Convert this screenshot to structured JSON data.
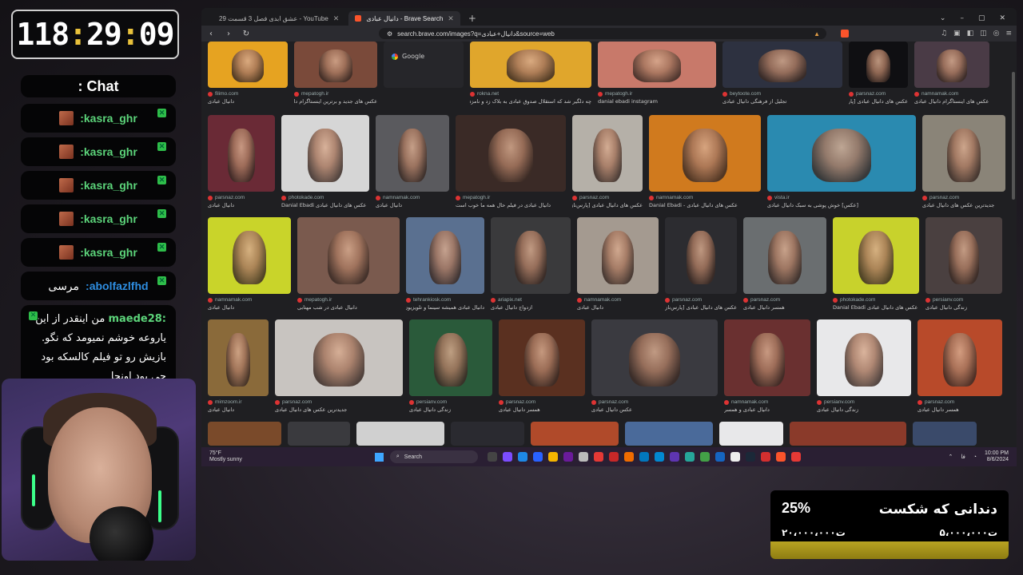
{
  "timer": {
    "hours": "118",
    "minutes": "29",
    "seconds": "09"
  },
  "chat": {
    "title": ": Chat",
    "messages": [
      {
        "user": ":kasra_ghr",
        "text": ""
      },
      {
        "user": ":kasra_ghr",
        "text": ""
      },
      {
        "user": ":kasra_ghr",
        "text": ""
      },
      {
        "user": ":kasra_ghr",
        "text": ""
      },
      {
        "user": ":kasra_ghr",
        "text": ""
      },
      {
        "user": ":abolfazlfhd",
        "text": "مرسی"
      }
    ],
    "long_message": {
      "user": ":maede28",
      "text": "من اینقدر از این یاروعه خوشم نمیومد که نگو. بازیش رو تو فیلم کالسکه بود چی بود اونجا"
    }
  },
  "browser": {
    "tabs": [
      {
        "label": "عشق ابدی فصل 3 قسمت 29 - YouTube",
        "active": false
      },
      {
        "label": "دانیال عبادی - Brave Search",
        "active": true
      }
    ],
    "url": "search.brave.com/images?q=دانیال+عبادی&source=web",
    "partial_card_label": "Google"
  },
  "rows": [
    {
      "cards": [
        {
          "src": "filimo.com",
          "cap": "دانیال عبادی",
          "color": "#e6a321"
        },
        {
          "src": "mepatogh.ir",
          "cap": "عکس های جدید و برترین اینستاگرام دانیال عبادی",
          "color": "#7a4a3a"
        },
        {
          "src": "",
          "cap": "",
          "color": "#26262a"
        },
        {
          "src": "rokna.net",
          "cap": "چه دلگیر شد که استقلال صدوق عبادی به بلاک زد و نامزدی حاضر شد",
          "color": "#e0a62c"
        },
        {
          "src": "mepatogh.ir",
          "cap": "danial ebadi instagram",
          "color": "#c8796a"
        },
        {
          "src": "beytoote.com",
          "cap": "تجلیل از فرهنگی دانیال عبادی",
          "color": "#2d3140"
        },
        {
          "src": "parsnaz.com",
          "cap": "عکس های دانیال عبادی [پارس‌ناز]",
          "color": "#0f0f12"
        },
        {
          "src": "namnamak.com",
          "cap": "عکس های اینستاگرام دانیال عبادی",
          "color": "#4a3b46"
        }
      ]
    },
    {
      "cards": [
        {
          "src": "parsnaz.com",
          "cap": "دانیال عبادی",
          "color": "#6a2a36"
        },
        {
          "src": "photokade.com",
          "cap": "عکس های دانیال عبادی Danial Ebadi",
          "color": "#d6d6d6"
        },
        {
          "src": "namnamak.com",
          "cap": "دانیال عبادی",
          "color": "#5a5a5e"
        },
        {
          "src": "mepatogh.ir",
          "cap": "دانیال عبادی در فیلم حال همه ما خوب است",
          "color": "#3a2a26"
        },
        {
          "src": "parsnaz.com",
          "cap": "عکس های دانیال عبادی [پارس‌ناز]",
          "color": "#b5b0a8"
        },
        {
          "src": "namnamak.com",
          "cap": "عکس های دانیال عبادی - Danial Ebadi",
          "color": "#d07a1e"
        },
        {
          "src": "vista.ir",
          "cap": "[عکس] خوش پوشی به سبک دانیال عبادی",
          "color": "#2a8ab0"
        },
        {
          "src": "parsnaz.com",
          "cap": "جدیدترین عکس های دانیال عبادی",
          "color": "#8a8478"
        }
      ]
    },
    {
      "cards": [
        {
          "src": "namnamak.com",
          "cap": "دانیال عبادی",
          "color": "#c9d42a"
        },
        {
          "src": "mepatogh.ir",
          "cap": "دانیال عبادی در شب مهتابی",
          "color": "#7a5a4e"
        },
        {
          "src": "tehrankiosk.com",
          "cap": "دانیال عبادی همیشه سینما و تلویزیون ایران",
          "color": "#5a7090"
        },
        {
          "src": "ariapix.net",
          "cap": "ازدواج دانیال عبادی",
          "color": "#3a3a3c"
        },
        {
          "src": "namnamak.com",
          "cap": "دانیال عبادی",
          "color": "#a49a90"
        },
        {
          "src": "parsnaz.com",
          "cap": "عکس های دانیال عبادی [پارس‌ناز]",
          "color": "#2c2c30"
        },
        {
          "src": "parsnaz.com",
          "cap": "همسر دانیال عبادی",
          "color": "#6a6e70"
        },
        {
          "src": "photokade.com",
          "cap": "عکس های دانیال عبادی Danial Ebadi",
          "color": "#c8d22c"
        },
        {
          "src": "persianv.com",
          "cap": "زندگی دانیال عبادی",
          "color": "#4a4040"
        }
      ]
    },
    {
      "cards": [
        {
          "src": "mimzoom.ir",
          "cap": "دانیال عبادی",
          "color": "#8a6a3a"
        },
        {
          "src": "parsnaz.com",
          "cap": "جدیدترین عکس های دانیال عبادی",
          "color": "#c8c4c0"
        },
        {
          "src": "persianv.com",
          "cap": "زندگی دانیال عبادی",
          "color": "#2a5a3a"
        },
        {
          "src": "parsnaz.com",
          "cap": "همسر دانیال عبادی",
          "color": "#5a3020"
        },
        {
          "src": "parsnaz.com",
          "cap": "عکس دانیال عبادی",
          "color": "#3a3a40"
        },
        {
          "src": "namnamak.com",
          "cap": "دانیال عبادی و همسر",
          "color": "#6a3030"
        },
        {
          "src": "persianv.com",
          "cap": "زندگی دانیال عبادی",
          "color": "#e8e8ea"
        },
        {
          "src": "parsnaz.com",
          "cap": "همسر دانیال عبادی",
          "color": "#b84a2a"
        }
      ]
    }
  ],
  "taskbar": {
    "temperature": "75°F",
    "weather": "Mostly sunny",
    "search_label": "Search",
    "time": "10:00 PM",
    "date": "8/6/2024"
  },
  "goal": {
    "percent": "25%",
    "progress": 0.25,
    "title": "دندانی که شکست",
    "current": "۵،۰۰۰،۰۰۰ت",
    "target": "۲۰،۰۰۰،۰۰۰ت"
  }
}
